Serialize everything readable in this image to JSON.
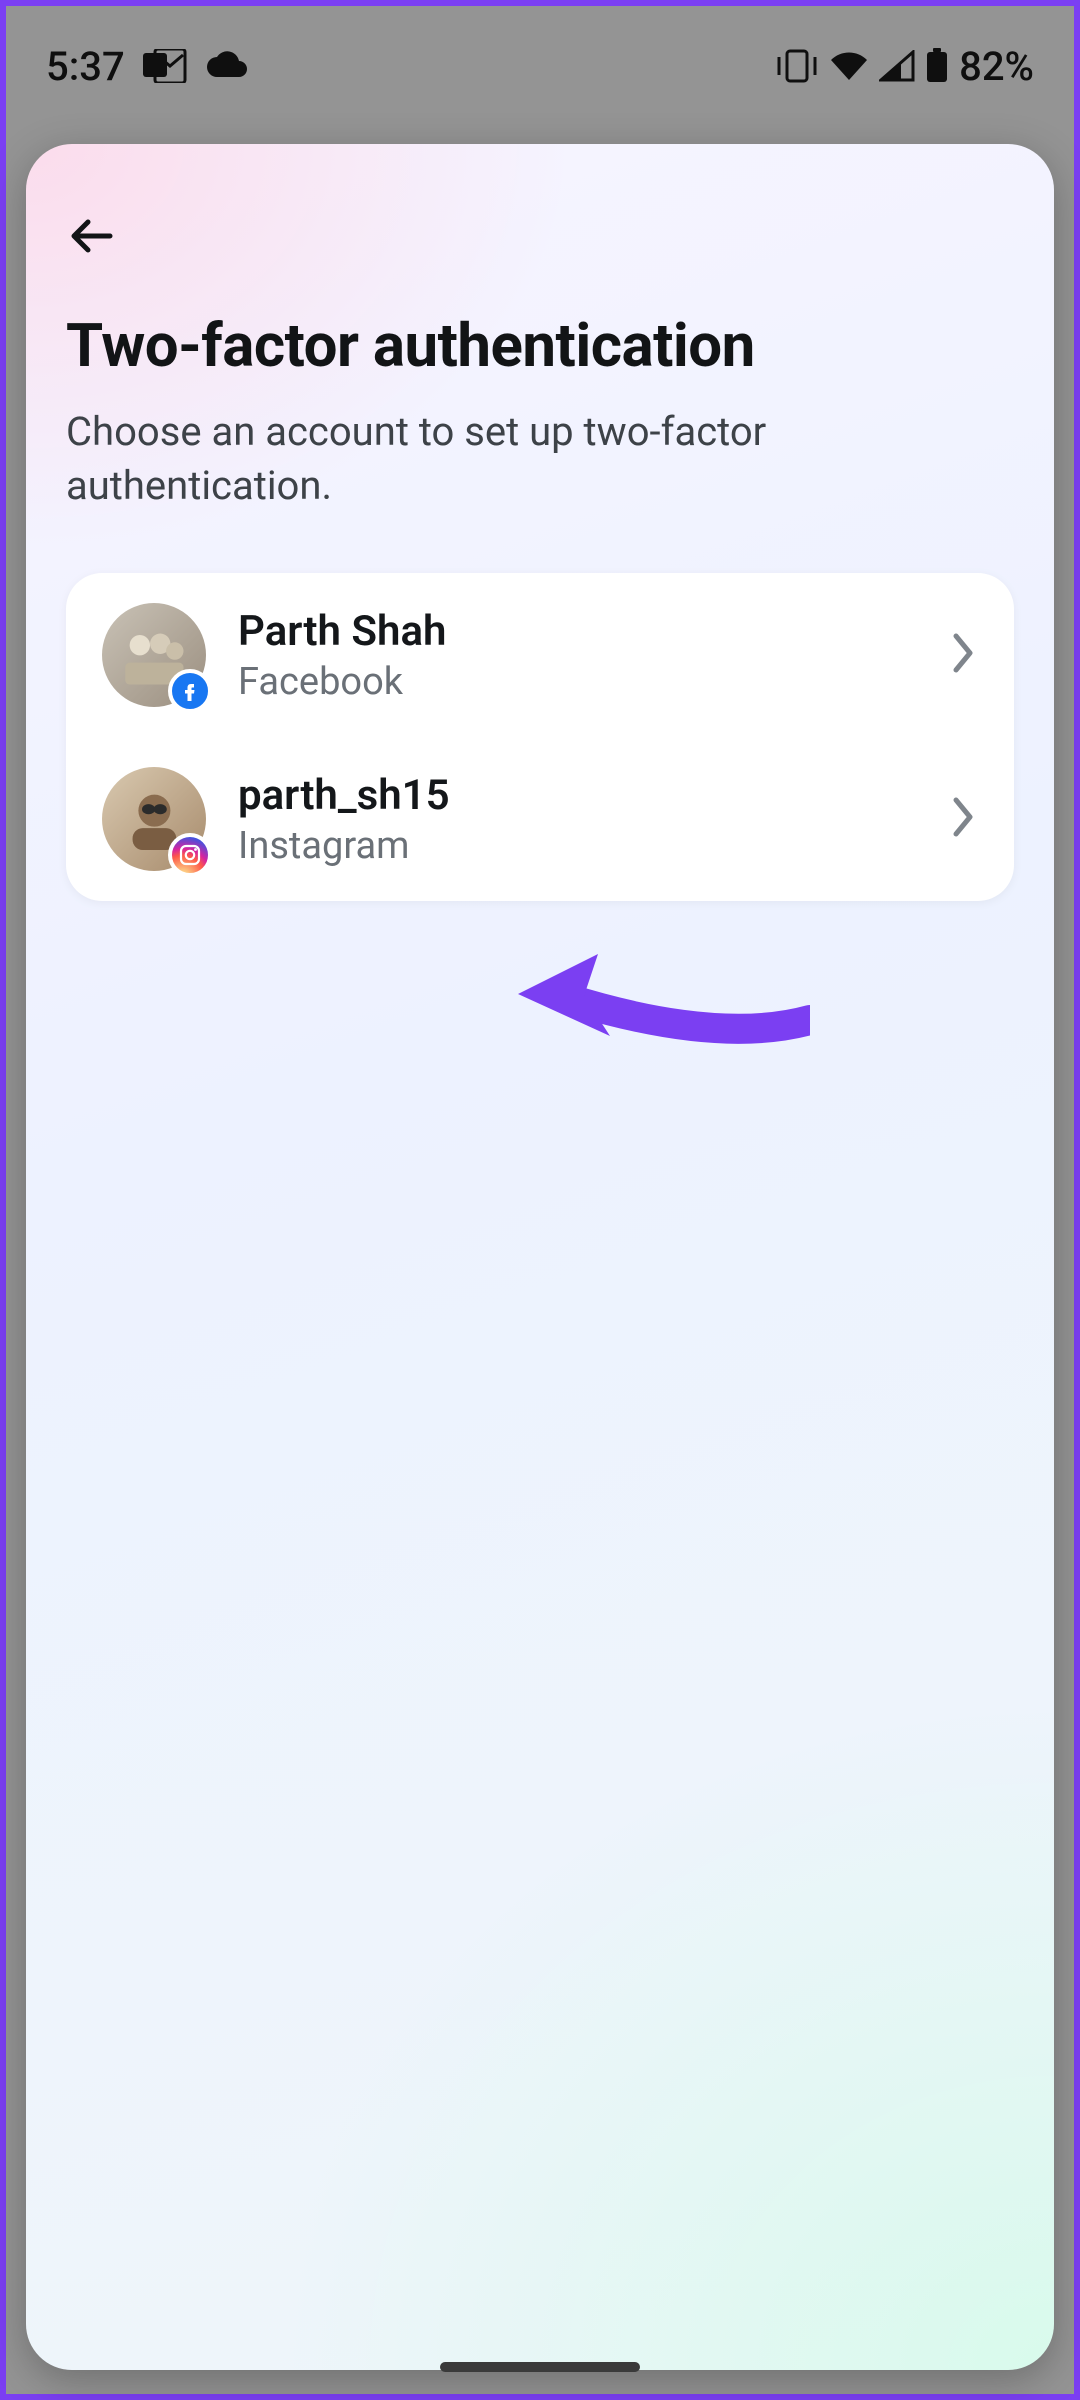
{
  "statusbar": {
    "time": "5:37",
    "battery": "82%"
  },
  "page": {
    "title": "Two-factor authentication",
    "subtitle": "Choose an account to set up two-factor authentication."
  },
  "accounts": [
    {
      "name": "Parth Shah",
      "platform": "Facebook"
    },
    {
      "name": "parth_sh15",
      "platform": "Instagram"
    }
  ]
}
